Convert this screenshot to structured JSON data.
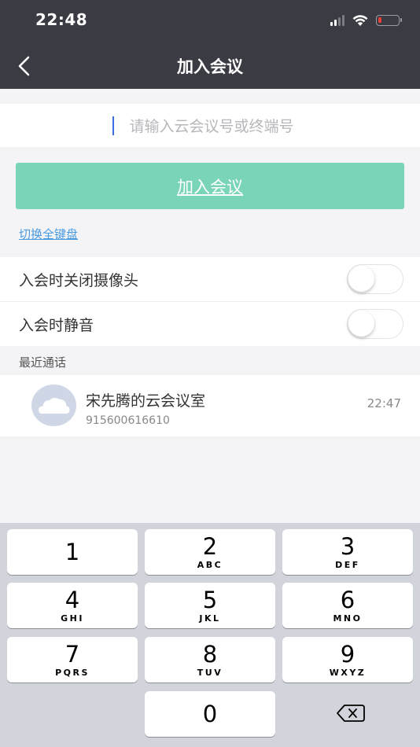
{
  "status_bar": {
    "time": "22:48"
  },
  "nav": {
    "title": "加入会议"
  },
  "join_form": {
    "input_placeholder": "请输入云会议号或终端号",
    "input_value": "",
    "join_button": "加入会议",
    "switch_keyboard": "切换全键盘"
  },
  "settings": {
    "camera_off_label": "入会时关闭摄像头",
    "camera_off_enabled": false,
    "mute_label": "入会时静音",
    "mute_enabled": false
  },
  "recent": {
    "section_title": "最近通话",
    "items": [
      {
        "name": "宋先腾的云会议室",
        "number": "915600616610",
        "time": "22:47"
      }
    ]
  },
  "keypad": {
    "keys": [
      {
        "num": "1",
        "letters": ""
      },
      {
        "num": "2",
        "letters": "ABC"
      },
      {
        "num": "3",
        "letters": "DEF"
      },
      {
        "num": "4",
        "letters": "GHI"
      },
      {
        "num": "5",
        "letters": "JKL"
      },
      {
        "num": "6",
        "letters": "MNO"
      },
      {
        "num": "7",
        "letters": "PQRS"
      },
      {
        "num": "8",
        "letters": "TUV"
      },
      {
        "num": "9",
        "letters": "WXYZ"
      },
      {
        "num": "0",
        "letters": ""
      }
    ]
  },
  "colors": {
    "header_bg": "#3a3b43",
    "accent_green": "#7ad4b8",
    "link_blue": "#4a9ae0",
    "battery_low": "#e8403a"
  }
}
